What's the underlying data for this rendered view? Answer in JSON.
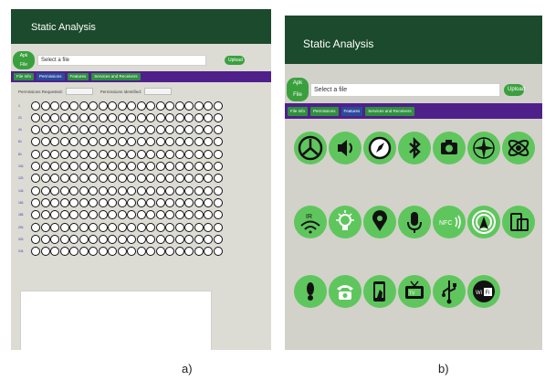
{
  "panel_a": {
    "title": "Static Analysis",
    "apk_button": "Apk File",
    "file_placeholder": "Select a file",
    "upload_button": "Upload",
    "tabs": [
      "File Info",
      "Permissions",
      "Features",
      "Services and Receivers"
    ],
    "active_tab": "Permissions",
    "permissions_requested_label": "Permissions Requested:",
    "permissions_identified_label": "Permissions Identified:",
    "row_labels": [
      "1",
      "21",
      "41",
      "61",
      "81",
      "101",
      "121",
      "141",
      "161",
      "181",
      "201",
      "221",
      "241"
    ],
    "circles_per_row": 20
  },
  "panel_b": {
    "title": "Static Analysis",
    "apk_button": "Apk File",
    "file_placeholder": "Select a file",
    "upload_button": "Upload",
    "tabs": [
      "File Info",
      "Permissions",
      "Features",
      "Services and Receivers"
    ],
    "active_tab": "Features",
    "features": [
      [
        "nfc-triangle-icon",
        "speaker-icon",
        "compass-icon",
        "bluetooth-icon",
        "camera-icon",
        "compass-rose-icon",
        "gyroscope-icon"
      ],
      [
        "infrared-icon",
        "light-bulb-icon",
        "location-pin-icon",
        "microphone-icon",
        "nfc-icon",
        "gps-signal-icon",
        "screen-rotation-icon"
      ],
      [
        "footprint-icon",
        "telephone-icon",
        "touchscreen-icon",
        "tv-icon",
        "usb-icon",
        "wifi-icon"
      ]
    ]
  },
  "captions": {
    "a": "a)",
    "b": "b)"
  },
  "colors": {
    "header": "#1c4a2c",
    "tabbar": "#50208a",
    "green": "#3aa03e",
    "feature_circle": "#5fc65d"
  }
}
